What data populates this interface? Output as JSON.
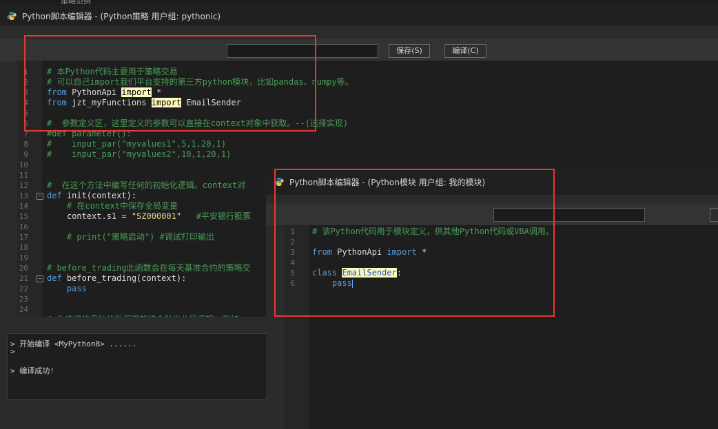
{
  "background_label": "策略范例",
  "main_window": {
    "title": "Python脚本编辑器 - (Python策略 用户组: pythonic)",
    "search_value": "",
    "save_label": "保存(S)",
    "compile_label": "编译(C)",
    "code_lines": [
      {
        "n": "1",
        "parts": [
          {
            "t": "# 本Python代码主要用于策略交易",
            "c": "cm"
          }
        ]
      },
      {
        "n": "2",
        "parts": [
          {
            "t": "# 可以自己import我们平台支持的第三方python模块，比如pandas、numpy等。",
            "c": "cm"
          }
        ]
      },
      {
        "n": "3",
        "parts": [
          {
            "t": "from",
            "c": "kw"
          },
          {
            "t": " PythonApi ",
            "c": "tx"
          },
          {
            "t": "import",
            "c": "hl"
          },
          {
            "t": " *",
            "c": "tx"
          }
        ]
      },
      {
        "n": "4",
        "parts": [
          {
            "t": "from",
            "c": "kw"
          },
          {
            "t": " jzt_myFunctions ",
            "c": "tx"
          },
          {
            "t": "import",
            "c": "hl"
          },
          {
            "t": " EmailSender",
            "c": "tx"
          }
        ]
      },
      {
        "n": "5",
        "parts": []
      },
      {
        "n": "6",
        "parts": [
          {
            "t": "#  参数定义区，这里定义的参数可以直接在context对象中获取。--(选择实现)",
            "c": "cm"
          }
        ]
      },
      {
        "n": "7",
        "parts": [
          {
            "t": "#def parameter():",
            "c": "cm"
          }
        ]
      },
      {
        "n": "8",
        "parts": [
          {
            "t": "#    input_par(\"myvalues1\",5,1,20,1)",
            "c": "cm"
          }
        ]
      },
      {
        "n": "9",
        "parts": [
          {
            "t": "#    input_par(\"myvalues2\",10,1,20,1)",
            "c": "cm"
          }
        ]
      },
      {
        "n": "10",
        "parts": []
      },
      {
        "n": "11",
        "parts": []
      },
      {
        "n": "12",
        "parts": [
          {
            "t": "#  在这个方法中编写任何的初始化逻辑。context对",
            "c": "cm"
          }
        ]
      },
      {
        "n": "13",
        "fold": true,
        "parts": [
          {
            "t": "def",
            "c": "kw"
          },
          {
            "t": " init(context):",
            "c": "tx"
          }
        ]
      },
      {
        "n": "14",
        "parts": [
          {
            "t": "    # 在context中保存全局变量",
            "c": "cm"
          }
        ]
      },
      {
        "n": "15",
        "parts": [
          {
            "t": "    context.s1 = ",
            "c": "tx"
          },
          {
            "t": "\"SZ000001\"",
            "c": "st"
          },
          {
            "t": "   #平安银行股票",
            "c": "cm"
          }
        ]
      },
      {
        "n": "16",
        "parts": []
      },
      {
        "n": "17",
        "parts": [
          {
            "t": "    # print(\"策略启动\") #调试打印输出",
            "c": "cm"
          }
        ]
      },
      {
        "n": "18",
        "parts": []
      },
      {
        "n": "19",
        "parts": []
      },
      {
        "n": "20",
        "parts": [
          {
            "t": "# before_trading此函数会在每天基准合约的策略交",
            "c": "cm"
          }
        ]
      },
      {
        "n": "21",
        "fold": true,
        "parts": [
          {
            "t": "def",
            "c": "kw"
          },
          {
            "t": " before_trading(context):",
            "c": "tx"
          }
        ]
      },
      {
        "n": "22",
        "parts": [
          {
            "t": "    pass",
            "c": "kw"
          }
        ]
      },
      {
        "n": "23",
        "parts": []
      },
      {
        "n": "24",
        "parts": []
      },
      {
        "n": "25",
        "parts": [
          {
            "t": "# 你选择的品种的数据更新将会触发此段逻辑，例如",
            "c": "cm"
          }
        ]
      }
    ],
    "console_lines": [
      "> 开始编译 <MyPython8> ......",
      ">",
      "",
      "> 编译成功!"
    ]
  },
  "module_window": {
    "title": "Python脚本编辑器 - (Python模块 用户组: 我的模块)",
    "search_value": "",
    "code_lines": [
      {
        "n": "1",
        "parts": [
          {
            "t": "# 该Python代码用于模块定义，供其他Python代码或VBA调用。",
            "c": "cm"
          }
        ]
      },
      {
        "n": "2",
        "parts": []
      },
      {
        "n": "3",
        "parts": [
          {
            "t": "from",
            "c": "kw"
          },
          {
            "t": " PythonApi ",
            "c": "tx"
          },
          {
            "t": "import",
            "c": "kw"
          },
          {
            "t": " *",
            "c": "tx"
          }
        ]
      },
      {
        "n": "4",
        "parts": []
      },
      {
        "n": "5",
        "parts": [
          {
            "t": "class",
            "c": "kw"
          },
          {
            "t": " ",
            "c": "tx"
          },
          {
            "t": "EmailSender",
            "c": "hlb"
          },
          {
            "t": ":",
            "c": "tx"
          }
        ]
      },
      {
        "n": "6",
        "parts": [
          {
            "t": "    pass",
            "c": "kw"
          }
        ]
      }
    ]
  },
  "colors": {
    "annotation_red": "#e53935",
    "highlight": "#fffbbf",
    "keyword": "#569cd6",
    "comment": "#4a9d58"
  }
}
